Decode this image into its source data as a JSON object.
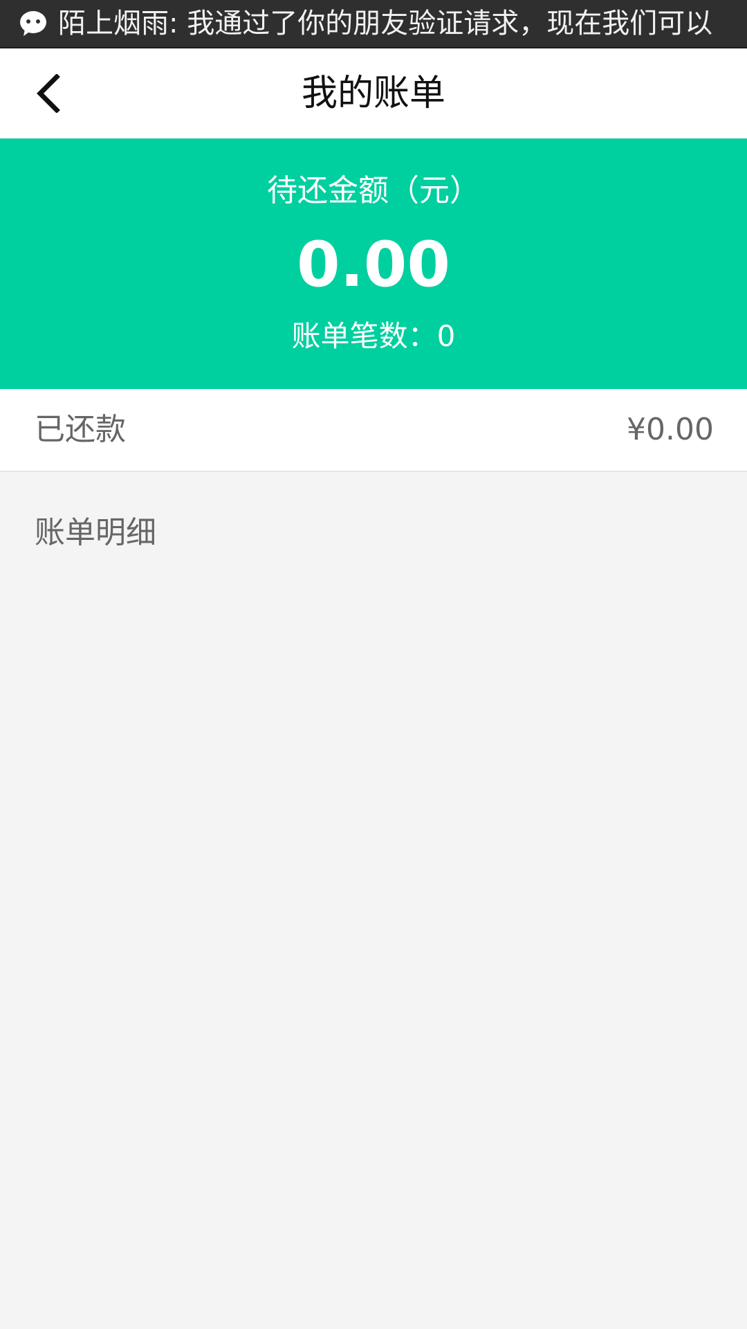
{
  "notification": {
    "icon": "wechat-icon",
    "text": "陌上烟雨: 我通过了你的朋友验证请求，现在我们可以"
  },
  "header": {
    "back_icon": "chevron-left-icon",
    "title": "我的账单"
  },
  "summary": {
    "label": "待还金额（元）",
    "amount": "0.00",
    "count_text": "账单笔数：0"
  },
  "paid": {
    "label": "已还款",
    "value": "¥0.00"
  },
  "details": {
    "label": "账单明细"
  },
  "colors": {
    "accent": "#00cf9f",
    "notification_bg": "#2f2f2f",
    "page_bg": "#f4f4f4",
    "secondary_text": "#666666"
  }
}
